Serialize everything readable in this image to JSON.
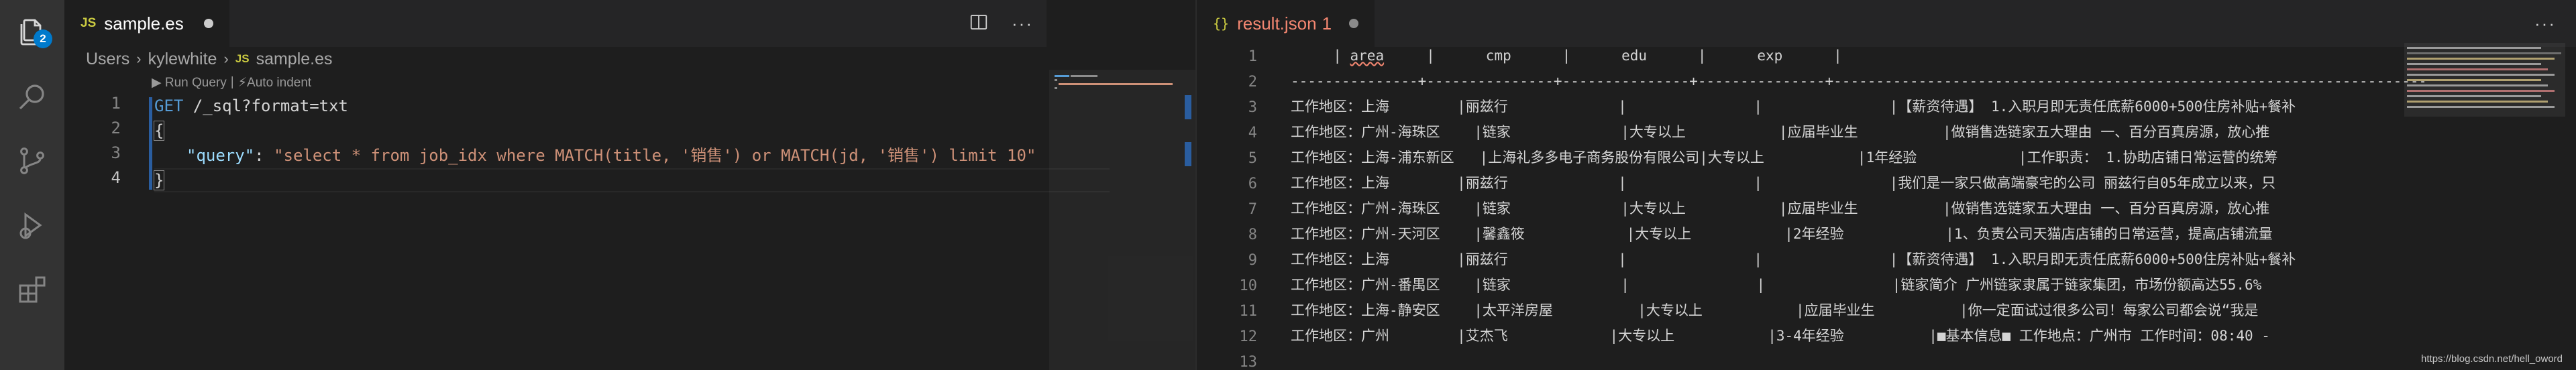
{
  "activity_bar": {
    "icons": [
      "explorer-icon",
      "search-icon",
      "source-control-icon",
      "run-debug-icon",
      "extensions-icon"
    ],
    "explorer_badge": "2"
  },
  "left_editor": {
    "tab": {
      "lang_badge": "JS",
      "filename": "sample.es"
    },
    "breadcrumb": [
      "Users",
      "kylewhite",
      "sample.es"
    ],
    "breadcrumb_file_badge": "JS",
    "codelens": {
      "run": "▶ Run Query",
      "separator": "|",
      "auto": "⚡Auto indent"
    },
    "line_numbers": [
      "1",
      "2",
      "3",
      "4"
    ],
    "code": {
      "line1_method": "GET",
      "line1_path": " /_sql?format=txt",
      "line2": "{",
      "line3_key": "\"query\"",
      "line3_colon": ": ",
      "line3_value": "\"select * from job_idx where MATCH(title, '销售') or MATCH(jd, '销售') limit 10\"",
      "line4": "}"
    }
  },
  "right_editor": {
    "tab": {
      "icon": "{}",
      "filename": "result.json",
      "problems": "1"
    },
    "line_numbers": [
      "1",
      "2",
      "3",
      "4",
      "5",
      "6",
      "7",
      "8",
      "9",
      "10",
      "11",
      "12",
      "13"
    ],
    "lines": [
      "     | area     |      cmp      |      edu      |      exp      |",
      "---------------+---------------+---------------+---------------+-------------------------------------------------------------------------------------------------------------------------------------------------------------------------------------",
      "工作地区：上海        |丽兹行             |               |               |【薪资待遇】 1.入职月即无责任底薪6000+500住房补贴+餐补",
      "工作地区：广州-海珠区    |链家             |大专以上           |应届毕业生          |做销售选链家五大理由 一、百分百真房源，放心推",
      "工作地区：上海-浦东新区   |上海礼多多电子商务股份有限公司|大专以上           |1年经验            |工作职责： 1.协助店铺日常运营的统筹",
      "工作地区：上海        |丽兹行             |               |               |我们是一家只做高端豪宅的公司 丽兹行自05年成立以来，只",
      "工作地区：广州-海珠区    |链家             |大专以上           |应届毕业生          |做销售选链家五大理由 一、百分百真房源，放心推",
      "工作地区：广州-天河区    |馨鑫筱            |大专以上           |2年经验            |1、负责公司天猫店店铺的日常运营，提高店铺流量",
      "工作地区：上海        |丽兹行             |               |               |【薪资待遇】 1.入职月即无责任底薪6000+500住房补贴+餐补",
      "工作地区：广州-番禺区    |链家             |               |               |链家简介 广州链家隶属于链家集团，市场份额高达55.6%",
      "工作地区：上海-静安区    |太平洋房屋          |大专以上           |应届毕业生          |你一定面试过很多公司！每家公司都会说“我是",
      "工作地区：广州        |艾杰飞            |大专以上           |3-4年经验          |■基本信息■ 工作地点：广州市 工作时间：08:40 -",
      ""
    ],
    "watermark": "https://blog.csdn.net/hell_oword"
  },
  "colors": {
    "accent": "#007acc",
    "keyword": "#569cd6",
    "string": "#ce9178",
    "json_key": "#9cdcfe",
    "error_filename": "#f48771"
  }
}
